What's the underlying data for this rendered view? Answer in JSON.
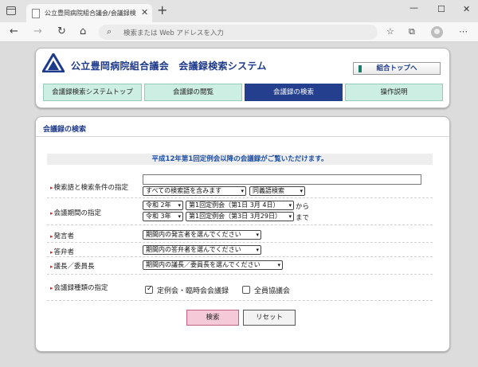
{
  "browser": {
    "tab_title": "公立豊岡病院組合議会/会議録検",
    "address_placeholder": "検索または Web アドレスを入力"
  },
  "header": {
    "site_title": "公立豊岡病院組合議会　会議録検索システム",
    "top_link": "組合トップへ",
    "nav_tabs": [
      {
        "label": "会議録検索システムトップ"
      },
      {
        "label": "会議録の閲覧"
      },
      {
        "label": "会議録の検索"
      },
      {
        "label": "操作説明"
      }
    ]
  },
  "main": {
    "section_title": "会議録の検索",
    "notice": "平成12年第1回定例会以降の会議録がご覧いただけます。",
    "rows": {
      "keyword": {
        "label": "検索語と検索条件の指定",
        "keyword_value": "",
        "condition": "すべての検索語を含みます",
        "synonym": "同義語検索"
      },
      "period": {
        "label": "会議期間の指定",
        "from_year": "令和 2年",
        "from_session": "第1回定例会（第1日 3月 4日）",
        "from_suffix": "から",
        "to_year": "令和 3年",
        "to_session": "第1回定例会（第3日 3月29日）",
        "to_suffix": "まで"
      },
      "speaker": {
        "label": "発言者",
        "value": "期間内の発言者を選んでください"
      },
      "answerer": {
        "label": "答弁者",
        "value": "期間内の答弁者を選んでください"
      },
      "chair": {
        "label": "議長／委員長",
        "value": "期間内の議長／委員長を選んでください"
      },
      "types": {
        "label": "会議録種類の指定",
        "options": [
          {
            "label": "定例会・臨時会会議録",
            "checked": true
          },
          {
            "label": "全員協議会",
            "checked": false
          }
        ]
      }
    },
    "search_button": "検索",
    "reset_button": "リセット"
  }
}
